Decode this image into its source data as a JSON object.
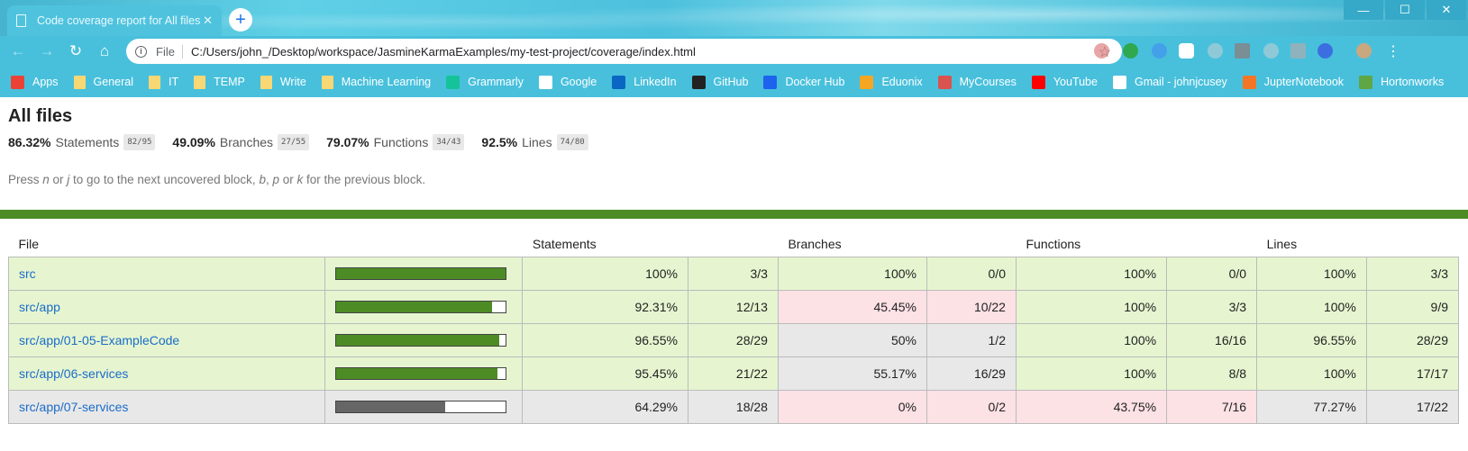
{
  "browser": {
    "tab_title": "Code coverage report for All files",
    "scheme_label": "File",
    "url": "C:/Users/john_/Desktop/workspace/JasmineKarmaExamples/my-test-project/coverage/index.html",
    "bookmarks": [
      {
        "label": "Apps",
        "icon": "apps-grid-icon",
        "color": "#ea4335"
      },
      {
        "label": "General",
        "icon": "folder-icon",
        "color": "#f8d775"
      },
      {
        "label": "IT",
        "icon": "folder-icon",
        "color": "#f8d775"
      },
      {
        "label": "TEMP",
        "icon": "folder-icon",
        "color": "#f8d775"
      },
      {
        "label": "Write",
        "icon": "folder-icon",
        "color": "#f8d775"
      },
      {
        "label": "Machine Learning",
        "icon": "folder-icon",
        "color": "#f8d775"
      },
      {
        "label": "Grammarly",
        "icon": "grammarly-icon",
        "color": "#15c39a"
      },
      {
        "label": "Google",
        "icon": "google-icon",
        "color": "#ffffff"
      },
      {
        "label": "LinkedIn",
        "icon": "linkedin-icon",
        "color": "#0a66c2"
      },
      {
        "label": "GitHub",
        "icon": "github-icon",
        "color": "#222222"
      },
      {
        "label": "Docker Hub",
        "icon": "docker-icon",
        "color": "#1d63ed"
      },
      {
        "label": "Eduonix",
        "icon": "eduonix-icon",
        "color": "#f5a623"
      },
      {
        "label": "MyCourses",
        "icon": "mycourses-icon",
        "color": "#d9534f"
      },
      {
        "label": "YouTube",
        "icon": "youtube-icon",
        "color": "#ff0000"
      },
      {
        "label": "Gmail - johnjcusey",
        "icon": "gmail-icon",
        "color": "#ffffff"
      },
      {
        "label": "JupterNotebook",
        "icon": "jupyter-icon",
        "color": "#f37626"
      },
      {
        "label": "Hortonworks",
        "icon": "hortonworks-icon",
        "color": "#5fa744"
      }
    ]
  },
  "report": {
    "title": "All files",
    "summary": [
      {
        "pct": "86.32%",
        "label": "Statements",
        "fraction": "82/95"
      },
      {
        "pct": "49.09%",
        "label": "Branches",
        "fraction": "27/55"
      },
      {
        "pct": "79.07%",
        "label": "Functions",
        "fraction": "34/43"
      },
      {
        "pct": "92.5%",
        "label": "Lines",
        "fraction": "74/80"
      }
    ],
    "hint": {
      "p1": "Press ",
      "k1": "n",
      "p2": " or ",
      "k2": "j",
      "p3": " to go to the next uncovered block, ",
      "k3": "b",
      "p4": ", ",
      "k4": "p",
      "p5": " or ",
      "k5": "k",
      "p6": " for the previous block."
    },
    "headers": {
      "file": "File",
      "statements": "Statements",
      "branches": "Branches",
      "functions": "Functions",
      "lines": "Lines"
    },
    "rows": [
      {
        "file": "src",
        "coverage": 1.0,
        "bar_color": "#4d8c25",
        "st_pct": "100%",
        "st_frac": "3/3",
        "st_level": "high",
        "br_pct": "100%",
        "br_frac": "0/0",
        "br_level": "high",
        "fn_pct": "100%",
        "fn_frac": "0/0",
        "fn_level": "high",
        "ln_pct": "100%",
        "ln_frac": "3/3",
        "ln_level": "high"
      },
      {
        "file": "src/app",
        "coverage": 0.9231,
        "bar_color": "#4d8c25",
        "st_pct": "92.31%",
        "st_frac": "12/13",
        "st_level": "high",
        "br_pct": "45.45%",
        "br_frac": "10/22",
        "br_level": "low",
        "fn_pct": "100%",
        "fn_frac": "3/3",
        "fn_level": "high",
        "ln_pct": "100%",
        "ln_frac": "9/9",
        "ln_level": "high"
      },
      {
        "file": "src/app/01-05-ExampleCode",
        "coverage": 0.9655,
        "bar_color": "#4d8c25",
        "st_pct": "96.55%",
        "st_frac": "28/29",
        "st_level": "high",
        "br_pct": "50%",
        "br_frac": "1/2",
        "br_level": "medium",
        "fn_pct": "100%",
        "fn_frac": "16/16",
        "fn_level": "high",
        "ln_pct": "96.55%",
        "ln_frac": "28/29",
        "ln_level": "high"
      },
      {
        "file": "src/app/06-services",
        "coverage": 0.9545,
        "bar_color": "#4d8c25",
        "st_pct": "95.45%",
        "st_frac": "21/22",
        "st_level": "high",
        "br_pct": "55.17%",
        "br_frac": "16/29",
        "br_level": "medium",
        "fn_pct": "100%",
        "fn_frac": "8/8",
        "fn_level": "high",
        "ln_pct": "100%",
        "ln_frac": "17/17",
        "ln_level": "high"
      },
      {
        "file": "src/app/07-services",
        "coverage": 0.6429,
        "bar_color": "#666666",
        "st_pct": "64.29%",
        "st_frac": "18/28",
        "st_level": "medium",
        "br_pct": "0%",
        "br_frac": "0/2",
        "br_level": "low",
        "fn_pct": "43.75%",
        "fn_frac": "7/16",
        "fn_level": "low",
        "ln_pct": "77.27%",
        "ln_frac": "17/22",
        "ln_level": "medium"
      }
    ]
  }
}
